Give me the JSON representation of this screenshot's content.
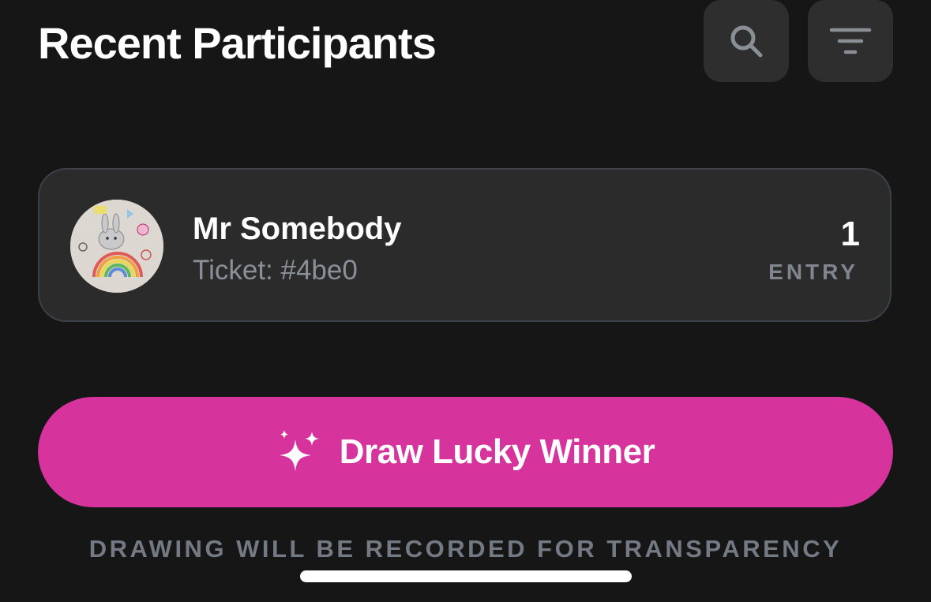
{
  "header": {
    "title": "Recent Participants"
  },
  "toolbar": {
    "search_icon": "search-icon",
    "filter_icon": "filter-icon"
  },
  "participants": [
    {
      "name": "Mr Somebody",
      "ticket": "Ticket: #4be0",
      "entry_count": "1",
      "entry_label": "ENTRY",
      "avatar": "drawing-avatar"
    }
  ],
  "actions": {
    "draw_label": "Draw Lucky Winner",
    "draw_icon": "sparkles-icon",
    "draw_color": "#d6339d"
  },
  "footnote": "DRAWING WILL BE RECORDED FOR TRANSPARENCY"
}
